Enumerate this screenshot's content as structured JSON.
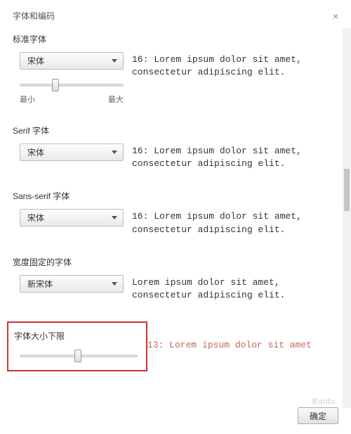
{
  "dialog": {
    "title": "字体和编码"
  },
  "sections": {
    "standard": {
      "label": "标准字体",
      "font": "宋体",
      "preview": "16: Lorem ipsum dolor sit amet, consectetur adipiscing elit.",
      "slider_min": "最小",
      "slider_max": "最大"
    },
    "serif": {
      "label": "Serif 字体",
      "font": "宋体",
      "preview": "16: Lorem ipsum dolor sit amet, consectetur adipiscing elit."
    },
    "sansserif": {
      "label": "Sans-serif 字体",
      "font": "宋体",
      "preview": "16: Lorem ipsum dolor sit amet, consectetur adipiscing elit."
    },
    "fixed": {
      "label": "宽度固定的字体",
      "font": "新宋体",
      "preview": "Lorem ipsum dolor sit amet, consectetur adipiscing elit."
    },
    "minsize": {
      "label": "字体大小下限",
      "preview": "13: Lorem ipsum dolor sit amet"
    }
  },
  "buttons": {
    "ok": "确定"
  },
  "watermark": "Baidu"
}
